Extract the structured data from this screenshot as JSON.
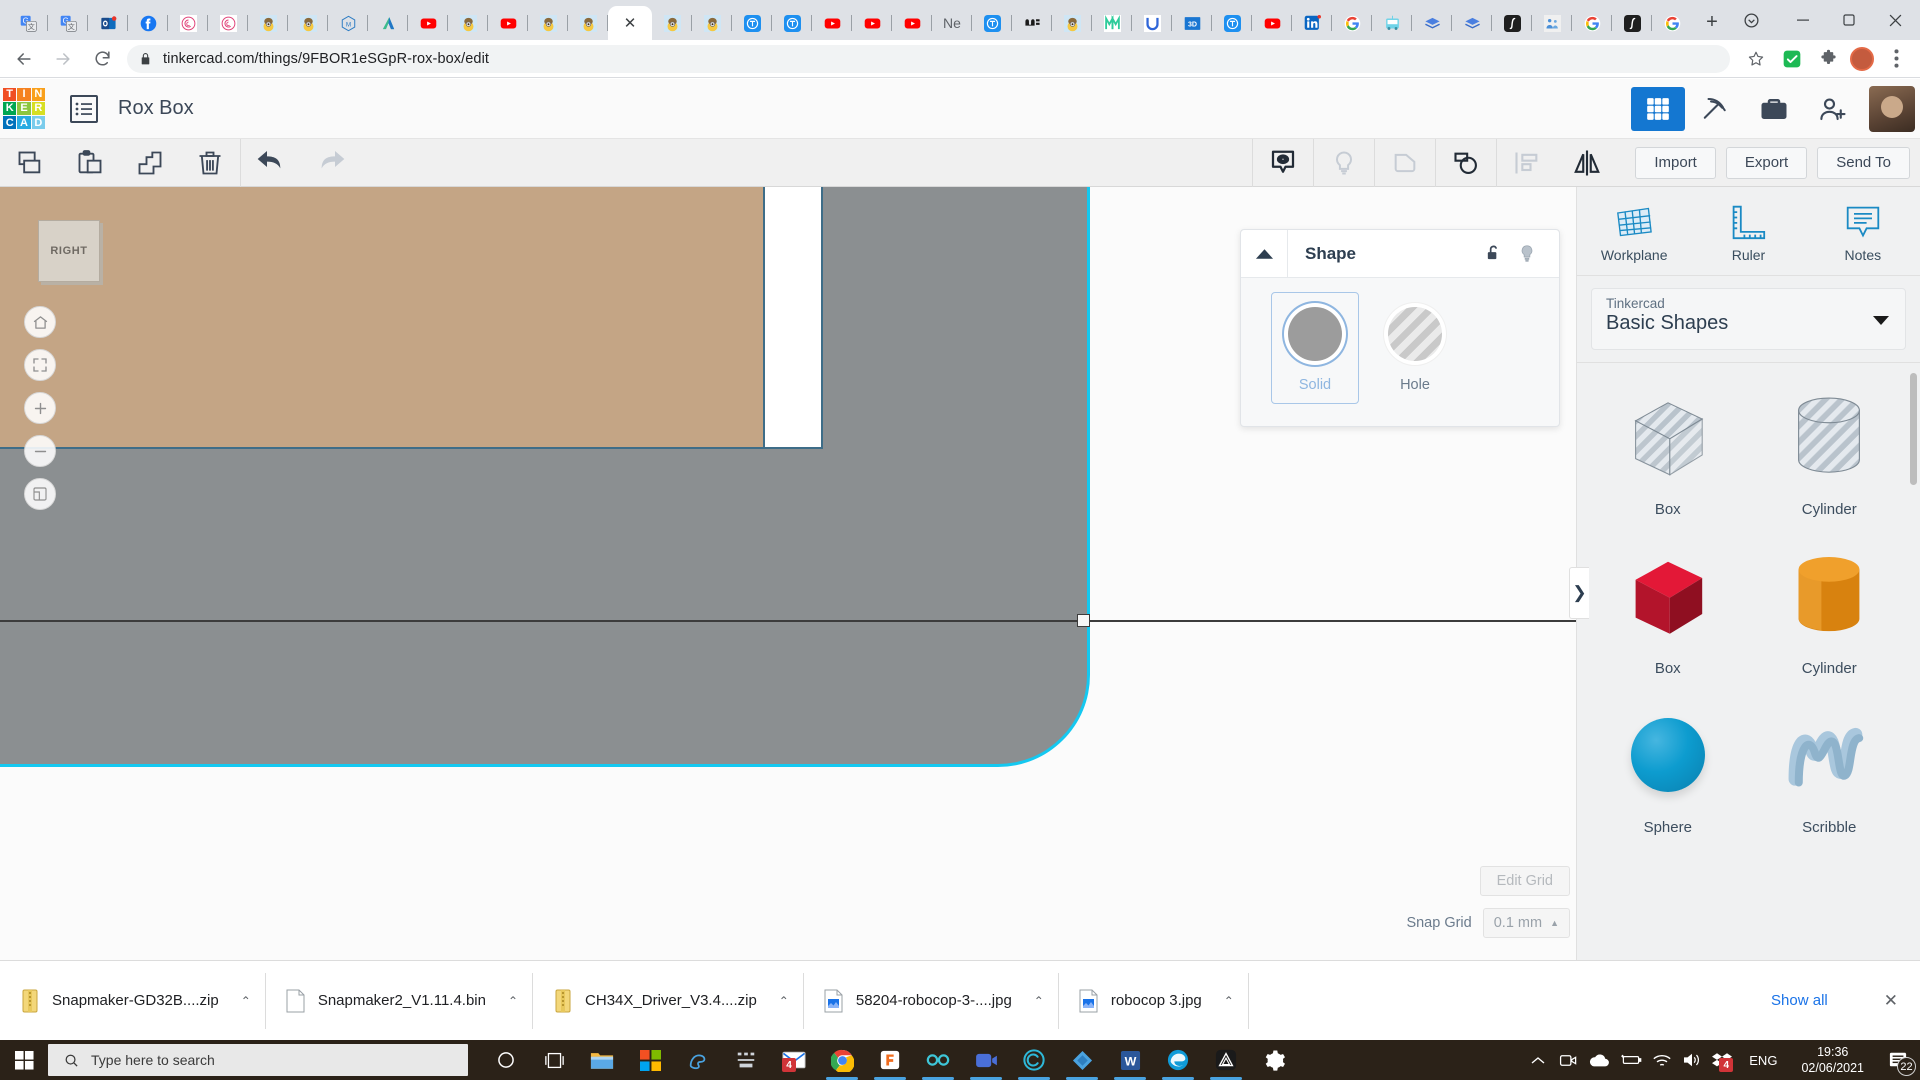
{
  "browser": {
    "tabs": [
      {
        "icon": "google-translate-icon",
        "active": false
      },
      {
        "icon": "google-translate-icon",
        "active": false
      },
      {
        "icon": "outlook-icon",
        "active": false
      },
      {
        "icon": "facebook-icon",
        "active": false
      },
      {
        "icon": "rose-icon",
        "active": false
      },
      {
        "icon": "rose-icon",
        "active": false
      },
      {
        "icon": "minion-icon",
        "active": false
      },
      {
        "icon": "minion-icon",
        "active": false
      },
      {
        "icon": "hexagon-m-icon",
        "active": false
      },
      {
        "icon": "autodesk-icon",
        "active": false
      },
      {
        "icon": "youtube-icon",
        "active": false
      },
      {
        "icon": "minion-icon",
        "active": false
      },
      {
        "icon": "youtube-icon",
        "active": false
      },
      {
        "icon": "minion-icon",
        "active": false
      },
      {
        "icon": "minion-icon",
        "active": false
      },
      {
        "icon": "close-icon",
        "active": true,
        "label": "✕"
      },
      {
        "icon": "minion-icon",
        "active": false
      },
      {
        "icon": "minion-icon",
        "active": false
      },
      {
        "icon": "tinkercad-icon",
        "active": false
      },
      {
        "icon": "tinkercad-icon",
        "active": false
      },
      {
        "icon": "youtube-icon",
        "active": false
      },
      {
        "icon": "youtube-icon",
        "active": false
      },
      {
        "icon": "youtube-icon",
        "active": false
      },
      {
        "icon": "text-icon",
        "active": false,
        "label": "Ne"
      },
      {
        "icon": "tinkercad-icon",
        "active": false
      },
      {
        "icon": "we-icon",
        "active": false
      },
      {
        "icon": "minion-icon",
        "active": false
      },
      {
        "icon": "m-green-icon",
        "active": false
      },
      {
        "icon": "u-blue-icon",
        "active": false
      },
      {
        "icon": "threed-icon",
        "active": false
      },
      {
        "icon": "tinkercad-icon",
        "active": false
      },
      {
        "icon": "youtube-icon",
        "active": false
      },
      {
        "icon": "linkedin-icon",
        "active": false
      },
      {
        "icon": "google-icon",
        "active": false
      },
      {
        "icon": "kidbus-icon",
        "active": false
      },
      {
        "icon": "book-blue-icon",
        "active": false
      },
      {
        "icon": "book-blue-icon",
        "active": false
      },
      {
        "icon": "integral-icon",
        "active": false
      },
      {
        "icon": "people-icon",
        "active": false
      },
      {
        "icon": "google-icon",
        "active": false
      },
      {
        "icon": "integral-icon",
        "active": false
      },
      {
        "icon": "google-icon",
        "active": false
      }
    ],
    "new_tab_label": "+",
    "window_controls": {
      "minimize": "—",
      "maximize": "❐",
      "close": "✕"
    },
    "toolbar": {
      "back": "back-arrow",
      "forward": "forward-arrow",
      "reload": "reload-arrow",
      "url_domain": "tinkercad.com",
      "url_path": "/things/9FBOR1eSGpR-rox-box/edit",
      "url_full": "tinkercad.com/things/9FBOR1eSGpR-rox-box/edit",
      "star": "bookmark-star-icon",
      "extension_check": "extension-check-icon",
      "extension_puzzle": "extension-puzzle-icon",
      "menu": "chrome-menu-icon"
    }
  },
  "tinkercad": {
    "logo_tiles": [
      {
        "letter": "T",
        "color": "#f04e23"
      },
      {
        "letter": "I",
        "color": "#f58220"
      },
      {
        "letter": "N",
        "color": "#f9a01b"
      },
      {
        "letter": "K",
        "color": "#00a651"
      },
      {
        "letter": "E",
        "color": "#8dc63f"
      },
      {
        "letter": "R",
        "color": "#d7df23"
      },
      {
        "letter": "C",
        "color": "#0071bc"
      },
      {
        "letter": "A",
        "color": "#29abe2"
      },
      {
        "letter": "D",
        "color": "#7accec"
      }
    ],
    "menu_icon": "list-menu-icon",
    "document_title": "Rox Box",
    "header_actions": [
      {
        "name": "grid-view-button",
        "icon": "grid-icon",
        "active": true
      },
      {
        "name": "tools-button",
        "icon": "pickaxe-icon",
        "active": false
      },
      {
        "name": "gallery-button",
        "icon": "briefcase-icon",
        "active": false
      },
      {
        "name": "add-user-button",
        "icon": "user-plus-icon",
        "active": false
      },
      {
        "name": "account-avatar",
        "icon": "avatar-icon",
        "active": false
      }
    ],
    "toolbar_left": [
      {
        "name": "copy-button",
        "icon": "copy-icon"
      },
      {
        "name": "paste-button",
        "icon": "paste-icon"
      },
      {
        "name": "duplicate-button",
        "icon": "duplicate-icon"
      },
      {
        "name": "delete-button",
        "icon": "trash-icon"
      },
      {
        "name": "undo-button",
        "icon": "undo-arrow-icon"
      },
      {
        "name": "redo-button",
        "icon": "redo-arrow-icon"
      }
    ],
    "toolbar_right": [
      {
        "name": "show-hide-button",
        "icon": "eye-bubble-icon",
        "enabled": true
      },
      {
        "name": "light-button",
        "icon": "lightbulb-icon",
        "enabled": false
      },
      {
        "name": "group-button",
        "icon": "group-shape-icon",
        "enabled": false
      },
      {
        "name": "ungroup-button",
        "icon": "ungroup-shape-icon",
        "enabled": true
      },
      {
        "name": "align-button",
        "icon": "align-icon",
        "enabled": false
      },
      {
        "name": "mirror-button",
        "icon": "mirror-icon",
        "enabled": true
      }
    ],
    "actions": {
      "import": "Import",
      "export": "Export",
      "send_to": "Send To"
    },
    "view_cube_label": "RIGHT",
    "view_tools": [
      {
        "name": "home-view-button",
        "icon": "home-icon"
      },
      {
        "name": "fit-view-button",
        "icon": "fit-frame-icon"
      },
      {
        "name": "zoom-in-button",
        "icon": "plus-icon"
      },
      {
        "name": "zoom-out-button",
        "icon": "minus-icon"
      },
      {
        "name": "ortho-toggle-button",
        "icon": "box-perspective-icon"
      }
    ],
    "shape_panel": {
      "title": "Shape",
      "collapse_icon": "triangle-up-icon",
      "lock_icon": "unlock-icon",
      "light_icon": "lightbulb-icon",
      "options": [
        {
          "label": "Solid",
          "selected": true
        },
        {
          "label": "Hole",
          "selected": false
        }
      ]
    },
    "grid_controls": {
      "edit_grid_label": "Edit Grid",
      "snap_grid_label": "Snap Grid",
      "snap_grid_value": "0.1 mm",
      "snap_caret": "▲"
    },
    "panel_collapse_icon": "❯",
    "sidebar": {
      "tools": [
        {
          "label": "Workplane",
          "icon": "workplane-icon"
        },
        {
          "label": "Ruler",
          "icon": "ruler-icon"
        },
        {
          "label": "Notes",
          "icon": "notes-icon"
        }
      ],
      "library_owner": "Tinkercad",
      "library_name": "Basic Shapes",
      "shapes": [
        {
          "label": "Box",
          "style": "hatched-box"
        },
        {
          "label": "Cylinder",
          "style": "hatched-cylinder"
        },
        {
          "label": "Box",
          "style": "red-box"
        },
        {
          "label": "Cylinder",
          "style": "orange-cylinder"
        },
        {
          "label": "Sphere",
          "style": "blue-sphere"
        },
        {
          "label": "Scribble",
          "style": "blue-scribble"
        }
      ]
    },
    "colors": {
      "accent_blue": "#1477d1",
      "selection_cyan": "#14c8f0",
      "model_gray": "#8b8f91",
      "model_tan": "#c4a585",
      "red_box": "#c0182b",
      "orange_cylinder": "#e08717",
      "blue_sphere": "#0d9ccf"
    }
  },
  "downloads": {
    "items": [
      {
        "name": "Snapmaker-GD32B....zip",
        "icon": "zip-icon"
      },
      {
        "name": "Snapmaker2_V1.11.4.bin",
        "icon": "file-icon"
      },
      {
        "name": "CH34X_Driver_V3.4....zip",
        "icon": "zip-icon"
      },
      {
        "name": "58204-robocop-3-....jpg",
        "icon": "image-icon"
      },
      {
        "name": "robocop 3.jpg",
        "icon": "image-icon"
      }
    ],
    "caret": "⌃",
    "show_all_label": "Show all",
    "close_label": "✕"
  },
  "taskbar": {
    "start_icon": "windows-start-icon",
    "search_placeholder": "Type here to search",
    "search_icon": "search-icon",
    "apps": [
      {
        "name": "cortana",
        "icon": "cortana-circle-icon",
        "running": false
      },
      {
        "name": "task-view",
        "icon": "task-view-icon",
        "running": false
      },
      {
        "name": "file-explorer",
        "icon": "folder-icon",
        "running": false
      },
      {
        "name": "microsoft-store",
        "icon": "store-icon",
        "running": false
      },
      {
        "name": "paint-3d",
        "icon": "paint3d-icon",
        "running": false
      },
      {
        "name": "pixel-app",
        "icon": "pixel-icon",
        "running": false
      },
      {
        "name": "mail",
        "icon": "mail-icon",
        "running": false,
        "badge": "4"
      },
      {
        "name": "chrome",
        "icon": "chrome-icon",
        "running": true
      },
      {
        "name": "foxit-reader",
        "icon": "foxit-icon",
        "running": true
      },
      {
        "name": "infinity-app",
        "icon": "infinity-icon",
        "running": true
      },
      {
        "name": "video-app",
        "icon": "camera-icon",
        "running": true
      },
      {
        "name": "code-app",
        "icon": "c-circle-icon",
        "running": true
      },
      {
        "name": "diamond-app",
        "icon": "diamond-icon",
        "running": true
      },
      {
        "name": "word",
        "icon": "word-icon",
        "running": true
      },
      {
        "name": "edge",
        "icon": "edge-icon",
        "running": true
      },
      {
        "name": "autodesk-app",
        "icon": "autodesk-triangle-icon",
        "running": true
      },
      {
        "name": "settings",
        "icon": "gear-icon",
        "running": false
      }
    ],
    "tray": {
      "expand": "⌃",
      "icons": [
        "meet-camera-icon",
        "onedrive-cloud-icon",
        "battery-icon",
        "wifi-icon",
        "volume-icon",
        "dropbox-icon"
      ],
      "dropbox_badge": "4",
      "language": "ENG",
      "time": "19:36",
      "date": "02/06/2021",
      "notification_count": "22"
    }
  }
}
